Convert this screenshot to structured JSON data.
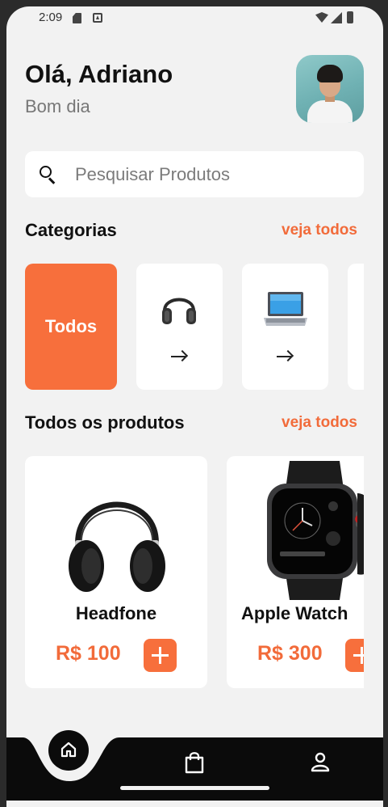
{
  "status_bar": {
    "time": "2:09"
  },
  "greeting": {
    "title": "Olá, Adriano",
    "subtitle": "Bom dia"
  },
  "search": {
    "placeholder": "Pesquisar Produtos"
  },
  "categories": {
    "title": "Categorias",
    "see_all": "veja todos",
    "active_label": "Todos",
    "items": [
      {
        "icon": "headphone-icon"
      },
      {
        "icon": "laptop-icon"
      }
    ]
  },
  "products": {
    "title": "Todos os produtos",
    "see_all": "veja todos",
    "items": [
      {
        "name": "Headfone",
        "price": "R$ 100",
        "icon": "headphone-image"
      },
      {
        "name": "Apple Watch",
        "price": "R$ 300",
        "icon": "apple-watch-image"
      }
    ]
  },
  "bottom_nav": {
    "items": [
      "home-icon",
      "shopping-bag-icon",
      "profile-icon"
    ]
  },
  "colors": {
    "accent": "#f76f3c",
    "background": "#f2f2f2",
    "nav": "#0b0b0b"
  }
}
